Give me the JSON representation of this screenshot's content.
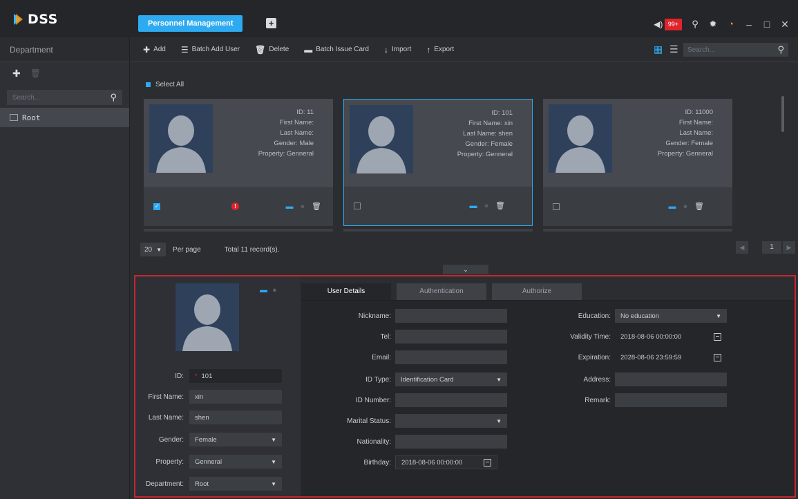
{
  "app": {
    "logo_text": "DSS",
    "active_tab": "Personnel Management",
    "add_tab": "+",
    "alarm_count": "99+"
  },
  "sidebar": {
    "header": "Department",
    "search_placeholder": "Search...",
    "root_label": "Root"
  },
  "toolbar": {
    "add": "Add",
    "batch_add_user": "Batch Add User",
    "delete": "Delete",
    "batch_issue_card": "Batch Issue Card",
    "import": "Import",
    "export": "Export",
    "search_placeholder": "Search..."
  },
  "list": {
    "select_all": "Select All",
    "field_labels": {
      "id": "ID:",
      "first_name": "First Name:",
      "last_name": "Last Name:",
      "gender": "Gender:",
      "property": "Property:"
    },
    "cards": [
      {
        "id": "11",
        "first_name": "",
        "last_name": "",
        "gender": "Male",
        "property": "Genneral",
        "checked": true,
        "warning": true
      },
      {
        "id": "101",
        "first_name": "xin",
        "last_name": "shen",
        "gender": "Female",
        "property": "Genneral",
        "checked": false,
        "warning": false
      },
      {
        "id": "11000",
        "first_name": "",
        "last_name": "",
        "gender": "Female",
        "property": "Genneral",
        "checked": false,
        "warning": false
      }
    ],
    "per_page_value": "20",
    "per_page_label": "Per page",
    "total": "Total 11 record(s).",
    "current_page": "1"
  },
  "detail": {
    "left": {
      "id_label": "ID:",
      "id_required": "*",
      "id_value": "101",
      "first_name_label": "First Name:",
      "first_name_value": "xin",
      "last_name_label": "Last Name:",
      "last_name_value": "shen",
      "gender_label": "Gender:",
      "gender_value": "Female",
      "property_label": "Property:",
      "property_value": "Genneral",
      "department_label": "Department:",
      "department_value": "Root"
    },
    "tabs": [
      "User Details",
      "Authentication",
      "Authorize"
    ],
    "fields": {
      "nickname_label": "Nickname:",
      "nickname_value": "",
      "tel_label": "Tel:",
      "tel_value": "",
      "email_label": "Email:",
      "email_value": "",
      "id_type_label": "ID Type:",
      "id_type_value": "Identification Card",
      "id_number_label": "ID Number:",
      "id_number_value": "",
      "marital_label": "Marital Status:",
      "marital_value": "",
      "nationality_label": "Nationality:",
      "nationality_value": "",
      "birthday_label": "Birthday:",
      "birthday_value": "2018-08-06 00:00:00",
      "education_label": "Education:",
      "education_value": "No education",
      "validity_label": "Validity Time:",
      "validity_value": "2018-08-06 00:00:00",
      "expiration_label": "Expiration:",
      "expiration_value": "2028-08-06 23:59:59",
      "address_label": "Address:",
      "address_value": "",
      "remark_label": "Remark:",
      "remark_value": ""
    }
  },
  "colors": {
    "accent": "#2eaaf0",
    "alert": "#e0242b",
    "highlight_border": "#c8262d"
  }
}
